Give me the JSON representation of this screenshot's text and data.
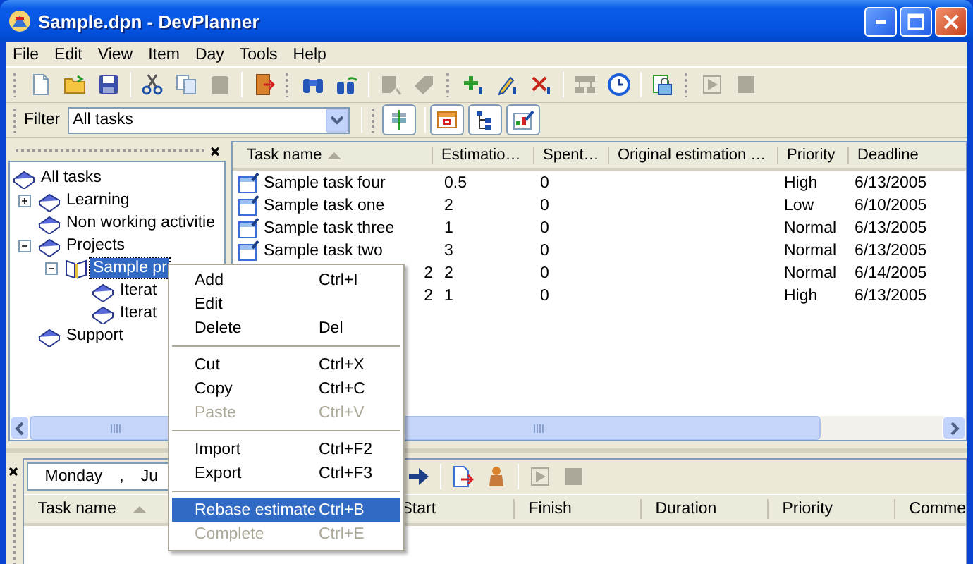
{
  "window": {
    "title": "Sample.dpn - DevPlanner"
  },
  "menu": [
    "File",
    "Edit",
    "View",
    "Item",
    "Day",
    "Tools",
    "Help"
  ],
  "toolbar": [
    {
      "disabled": false
    },
    {
      "disabled": false
    },
    {
      "disabled": false
    },
    {
      "disabled": false
    },
    {
      "disabled": false
    },
    {
      "disabled": true
    },
    {
      "disabled": false
    },
    {
      "disabled": false
    },
    {
      "disabled": false
    },
    {
      "disabled": true
    },
    {
      "disabled": true
    },
    {
      "disabled": false
    },
    {
      "disabled": false
    },
    {
      "disabled": false
    },
    {
      "disabled": true
    },
    {
      "disabled": false
    },
    {
      "disabled": false
    },
    {
      "disabled": true
    },
    {
      "disabled": true
    }
  ],
  "filter": {
    "label": "Filter",
    "value": "All tasks"
  },
  "tree": [
    {
      "label": "All tasks",
      "kind": "category",
      "selected": false,
      "children": [
        {
          "label": "Learning",
          "kind": "category",
          "selected": false,
          "expanded": false
        },
        {
          "label": "Non working activitie",
          "kind": "category",
          "selected": false
        },
        {
          "label": "Projects",
          "kind": "category",
          "selected": false,
          "expanded": true,
          "children": [
            {
              "label": "Sample pr",
              "kind": "project",
              "selected": true,
              "expanded": true,
              "children": [
                {
                  "label": "Iterat",
                  "kind": "iteration",
                  "selected": false
                },
                {
                  "label": "Iterat",
                  "kind": "iteration",
                  "selected": false
                }
              ]
            }
          ]
        },
        {
          "label": "Support",
          "kind": "category",
          "selected": false
        }
      ]
    }
  ],
  "tasks": {
    "columns": [
      {
        "label": "Task name",
        "sorted": true
      },
      {
        "label": "Estimatio…",
        "sorted": false
      },
      {
        "label": "Spent…",
        "sorted": false
      },
      {
        "label": "Original estimation …",
        "sorted": false
      },
      {
        "label": "Priority",
        "sorted": false
      },
      {
        "label": "Deadline",
        "sorted": false
      }
    ],
    "rows": [
      {
        "kind": "task",
        "name": "Sample task four",
        "estimation": "0.5",
        "spent": "0",
        "priority": "High",
        "deadline": "6/13/2005"
      },
      {
        "kind": "task",
        "name": "Sample task one",
        "estimation": "2",
        "spent": "0",
        "priority": "Low",
        "deadline": "6/10/2005"
      },
      {
        "kind": "task",
        "name": "Sample task three",
        "estimation": "1",
        "spent": "0",
        "priority": "Normal",
        "deadline": "6/13/2005"
      },
      {
        "kind": "task",
        "name": "Sample task two",
        "estimation": "3",
        "spent": "0",
        "priority": "Normal",
        "deadline": "6/13/2005"
      },
      {
        "kind": "covered",
        "name": "2",
        "estimation": "2",
        "spent": "0",
        "priority": "Normal",
        "deadline": "6/14/2005"
      },
      {
        "kind": "covered",
        "name": "2",
        "estimation": "1",
        "spent": "0",
        "priority": "High",
        "deadline": "6/13/2005"
      }
    ]
  },
  "schedule": {
    "date_parts": [
      "Monday",
      ",",
      "Ju"
    ],
    "buttons": [
      {
        "disabled": false
      },
      {
        "disabled": false
      },
      {
        "disabled": false
      },
      {
        "disabled": true
      },
      {
        "disabled": true
      }
    ],
    "columns": [
      {
        "label": "Task name",
        "sorted": true
      },
      {
        "label": "Start",
        "sorted": false
      },
      {
        "label": "Finish",
        "sorted": false
      },
      {
        "label": "Duration",
        "sorted": false
      },
      {
        "label": "Priority",
        "sorted": false
      },
      {
        "label": "Comme",
        "sorted": false
      }
    ]
  },
  "context_menu": [
    {
      "kind": "item",
      "label": "Add",
      "shortcut": "Ctrl+I",
      "disabled": false,
      "selected": false
    },
    {
      "kind": "item",
      "label": "Edit",
      "disabled": false,
      "selected": false
    },
    {
      "kind": "item",
      "label": "Delete",
      "shortcut": "Del",
      "disabled": false,
      "selected": false
    },
    {
      "kind": "separator"
    },
    {
      "kind": "item",
      "label": "Cut",
      "shortcut": "Ctrl+X",
      "disabled": false,
      "selected": false
    },
    {
      "kind": "item",
      "label": "Copy",
      "shortcut": "Ctrl+C",
      "disabled": false,
      "selected": false
    },
    {
      "kind": "item",
      "label": "Paste",
      "shortcut": "Ctrl+V",
      "disabled": true,
      "selected": false
    },
    {
      "kind": "separator"
    },
    {
      "kind": "item",
      "label": "Import",
      "shortcut": "Ctrl+F2",
      "disabled": false,
      "selected": false
    },
    {
      "kind": "item",
      "label": "Export",
      "shortcut": "Ctrl+F3",
      "disabled": false,
      "selected": false
    },
    {
      "kind": "separator"
    },
    {
      "kind": "item",
      "label": "Rebase estimate",
      "shortcut": "Ctrl+B",
      "disabled": false,
      "selected": true
    },
    {
      "kind": "item",
      "label": "Complete",
      "shortcut": "Ctrl+E",
      "disabled": true,
      "selected": false
    }
  ]
}
